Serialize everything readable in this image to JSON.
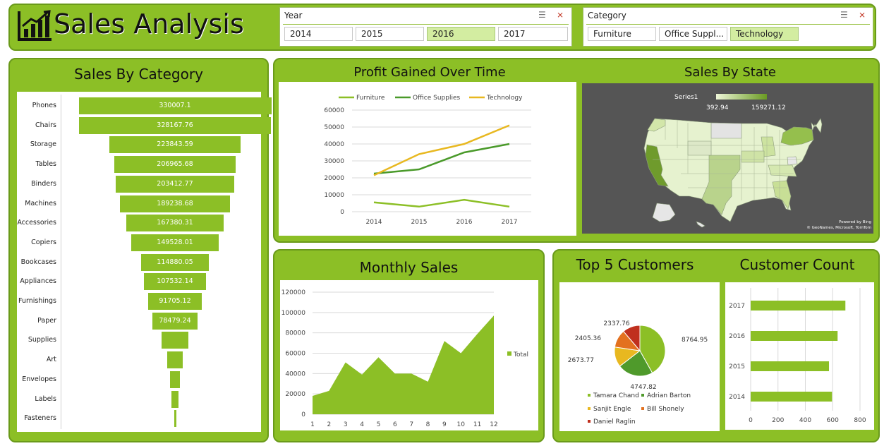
{
  "header": {
    "title": "Sales Analysis"
  },
  "slicers": {
    "year": {
      "title": "Year",
      "options": [
        "2014",
        "2015",
        "2016",
        "2017"
      ],
      "selected": "2016"
    },
    "category": {
      "title": "Category",
      "options": [
        "Furniture",
        "Office Suppl...",
        "Technology"
      ],
      "selected": "Technology"
    }
  },
  "sales_by_category": {
    "title": "Sales By Category",
    "items": [
      {
        "label": "Phones",
        "value": 330007.1,
        "text": "330007.1"
      },
      {
        "label": "Chairs",
        "value": 328167.76,
        "text": "328167.76"
      },
      {
        "label": "Storage",
        "value": 223843.59,
        "text": "223843.59"
      },
      {
        "label": "Tables",
        "value": 206965.68,
        "text": "206965.68"
      },
      {
        "label": "Binders",
        "value": 203412.77,
        "text": "203412.77"
      },
      {
        "label": "Machines",
        "value": 189238.68,
        "text": "189238.68"
      },
      {
        "label": "Accessories",
        "value": 167380.31,
        "text": "167380.31"
      },
      {
        "label": "Copiers",
        "value": 149528.01,
        "text": "149528.01"
      },
      {
        "label": "Bookcases",
        "value": 114880.05,
        "text": "114880.05"
      },
      {
        "label": "Appliances",
        "value": 107532.14,
        "text": "107532.14"
      },
      {
        "label": "Furnishings",
        "value": 91705.12,
        "text": "91705.12"
      },
      {
        "label": "Paper",
        "value": 78479.24,
        "text": "78479.24"
      },
      {
        "label": "Supplies",
        "value": 46673.54,
        "text": ""
      },
      {
        "label": "Art",
        "value": 27118.79,
        "text": ""
      },
      {
        "label": "Envelopes",
        "value": 16476.4,
        "text": ""
      },
      {
        "label": "Labels",
        "value": 12486.31,
        "text": ""
      },
      {
        "label": "Fasteners",
        "value": 3024.28,
        "text": ""
      }
    ]
  },
  "profit_over_time": {
    "title": "Profit Gained Over Time",
    "chart_data": {
      "type": "line",
      "categories": [
        "2014",
        "2015",
        "2016",
        "2017"
      ],
      "series": [
        {
          "name": "Furniture",
          "color": "#8cbf26",
          "values": [
            5500,
            3000,
            7000,
            3000
          ]
        },
        {
          "name": "Office Supplies",
          "color": "#4a9a2a",
          "values": [
            22500,
            25000,
            35000,
            40000
          ]
        },
        {
          "name": "Technology",
          "color": "#e8b820",
          "values": [
            21500,
            34000,
            40000,
            51000
          ]
        }
      ],
      "yticks": [
        "0",
        "10000",
        "20000",
        "30000",
        "40000",
        "50000",
        "60000"
      ],
      "ylim": [
        0,
        60000
      ]
    }
  },
  "sales_by_state": {
    "title": "Sales By State",
    "legend_series": "Series1",
    "legend_min": "392.94",
    "legend_max": "159271.12",
    "attribution_line1": "Powered by Bing",
    "attribution_line2": "© GeoNames, Microsoft, TomTom"
  },
  "monthly_sales": {
    "title": "Monthly Sales",
    "chart_data": {
      "type": "area",
      "categories": [
        "1",
        "2",
        "3",
        "4",
        "5",
        "6",
        "7",
        "8",
        "9",
        "10",
        "11",
        "12"
      ],
      "series": [
        {
          "name": "Total",
          "values": [
            18000,
            23000,
            51000,
            39000,
            56000,
            40000,
            40000,
            32000,
            72000,
            60000,
            79000,
            97000
          ]
        }
      ],
      "yticks": [
        "0",
        "20000",
        "40000",
        "60000",
        "80000",
        "100000",
        "120000"
      ],
      "ylim": [
        0,
        120000
      ]
    }
  },
  "top_customers": {
    "title": "Top 5 Customers",
    "chart_data": {
      "type": "pie",
      "slices": [
        {
          "name": "Tamara Chand",
          "value": 8764.95,
          "label": "8764.95",
          "color": "#8cbf26"
        },
        {
          "name": "Adrian Barton",
          "value": 4747.82,
          "label": "4747.82",
          "color": "#4f9a2b"
        },
        {
          "name": "Sanjit Engle",
          "value": 2673.77,
          "label": "2673.77",
          "color": "#e8b820"
        },
        {
          "name": "Bill Shonely",
          "value": 2405.36,
          "label": "2405.36",
          "color": "#e3711f"
        },
        {
          "name": "Daniel Raglin",
          "value": 2337.76,
          "label": "2337.76",
          "color": "#c0301e"
        }
      ]
    }
  },
  "customer_count": {
    "title": "Customer Count",
    "chart_data": {
      "type": "bar",
      "categories": [
        "2017",
        "2016",
        "2015",
        "2014"
      ],
      "values": [
        693,
        636,
        573,
        595
      ],
      "xticks": [
        "0",
        "200",
        "400",
        "600",
        "800"
      ],
      "xlim": [
        0,
        800
      ]
    }
  }
}
